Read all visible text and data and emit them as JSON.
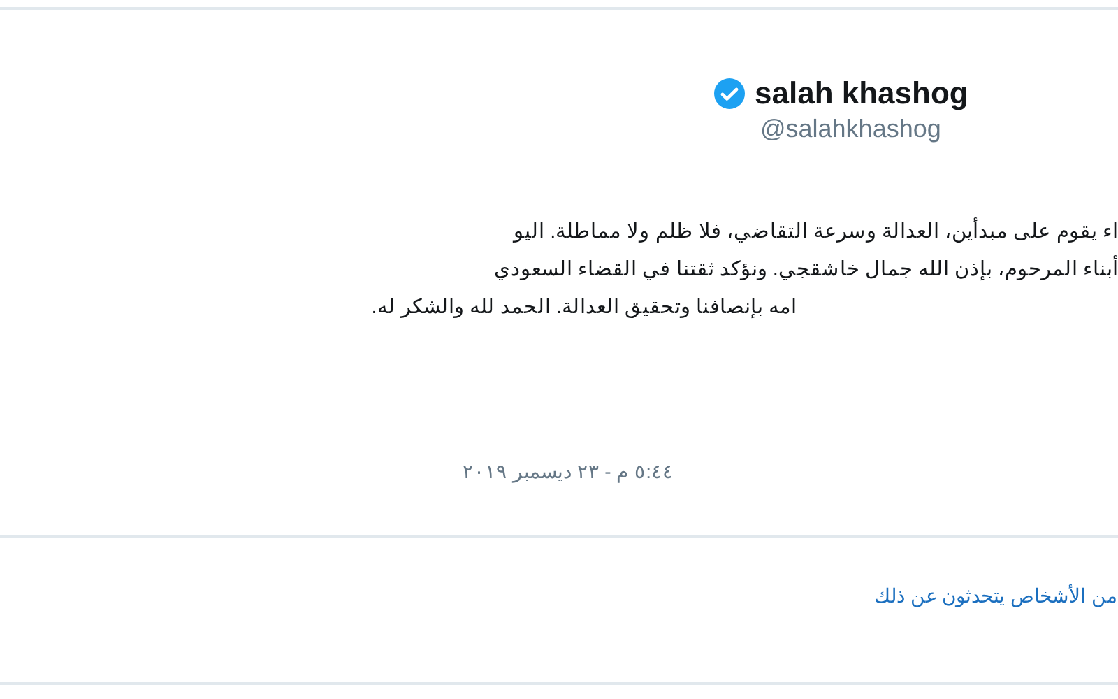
{
  "tweet": {
    "author": {
      "name": "salah khashog",
      "handle": "@salahkhashog",
      "verified": true
    },
    "text_lines": [
      "اء يقوم على مبدأين، العدالة وسرعة التقاضي، فلا ظلم ولا مماطلة. اليو",
      "أبناء المرحوم، بإذن الله جمال خاشقجي. ونؤكد ثقتنا في القضاء السعودي",
      "امه بإنصافنا وتحقيق العدالة. الحمد لله والشكر له."
    ],
    "timestamp": "٥:٤٤ م - ٢٣ ديسمبر ٢٠١٩",
    "conversation_link": "من الأشخاص يتحدثون عن ذلك"
  }
}
